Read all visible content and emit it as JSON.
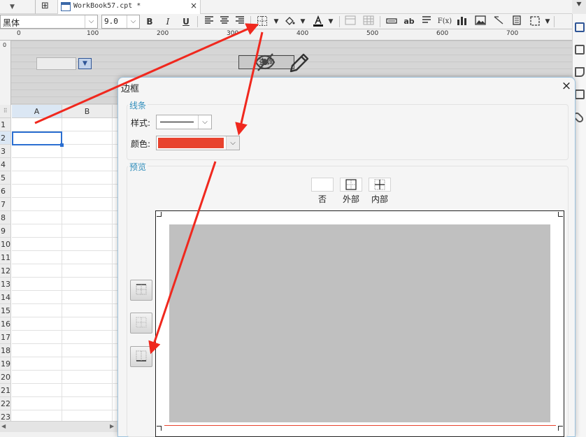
{
  "tabbar": {
    "document_title": "WorkBook57.cpt *",
    "close_glyph": "×",
    "layout_icon": "grid-layout-icon",
    "corner_icon": "pin-icon"
  },
  "toolbar": {
    "font_name": "黑体",
    "font_size": "9.0",
    "bold_label": "B",
    "italic_label": "I",
    "underline_label": "U",
    "text_icon_label": "ab",
    "formula_label": "F(x)",
    "icons": [
      "bold-icon",
      "italic-icon",
      "underline-icon",
      "align-left-icon",
      "align-center-icon",
      "align-right-icon",
      "border-icon",
      "fill-color-icon",
      "font-color-icon",
      "merge-cells-icon",
      "unmerge-cells-icon",
      "text-field-icon",
      "text-icon",
      "wrap-text-icon",
      "formula-icon",
      "chart-icon",
      "image-icon",
      "slash-icon",
      "sub-report-icon",
      "frame-icon"
    ]
  },
  "ruler": {
    "labels": [
      "0",
      "100",
      "200",
      "300",
      "400",
      "500",
      "600",
      "700"
    ],
    "vertical_label": "0"
  },
  "canvas": {
    "query_button_label": "查询"
  },
  "sheet": {
    "columns": [
      "A",
      "B"
    ],
    "rows": [
      "1",
      "2",
      "3",
      "4",
      "5",
      "6",
      "7",
      "8",
      "9",
      "10",
      "11",
      "12",
      "13",
      "14",
      "15",
      "16",
      "17",
      "18",
      "19",
      "20",
      "21",
      "22",
      "23"
    ],
    "selected_row": "2",
    "selected_column": "A"
  },
  "dialog": {
    "title": "边框",
    "close_glyph": "×",
    "line_group_label": "线条",
    "style_label": "样式:",
    "color_label": "颜色:",
    "selected_color": "#e8432e",
    "preview_group_label": "预览",
    "presets": [
      {
        "label": "否",
        "icon": "no-border-icon"
      },
      {
        "label": "外部",
        "icon": "outer-border-icon"
      },
      {
        "label": "内部",
        "icon": "inner-border-icon"
      }
    ],
    "side_buttons": [
      "top-border-icon",
      "horizontal-inner-border-icon",
      "bottom-border-icon"
    ]
  },
  "colors": {
    "annotation_arrow": "#f0281e",
    "accent_blue": "#2b6fd1",
    "group_label": "#2f8dbb",
    "preview_fill": "#c0c0c0",
    "preview_line": "#e8432e"
  }
}
